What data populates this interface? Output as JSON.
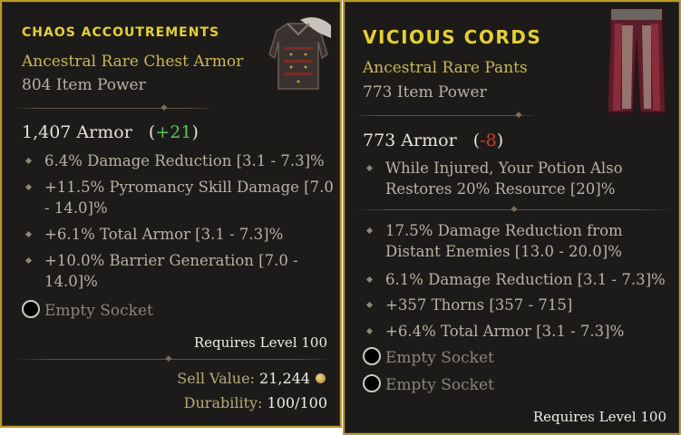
{
  "left_item": {
    "name": "CHAOS ACCOUTREMENTS",
    "subtype": "Ancestral Rare Chest Armor",
    "item_power": "804 Item Power",
    "armor_value": "1,407 Armor",
    "armor_delta": "+21",
    "affixes": [
      {
        "line1": "6.4% Damage Reduction [3.1 - 7.3]%",
        "line2": ""
      },
      {
        "line1": "+11.5% Pyromancy Skill Damage [7.0",
        "line2": "- 14.0]%"
      },
      {
        "line1": "+6.1% Total Armor [3.1 - 7.3]%",
        "line2": ""
      },
      {
        "line1": "+10.0% Barrier Generation [7.0 -",
        "line2": "14.0]%"
      }
    ],
    "sockets": [
      "Empty Socket"
    ],
    "requires": "Requires Level 100",
    "sell_label": "Sell Value:",
    "sell_value": "21,244",
    "durability_label": "Durability:",
    "durability_value": "100/100"
  },
  "right_item": {
    "name": "VICIOUS CORDS",
    "subtype": "Ancestral Rare Pants",
    "item_power": "773 Item Power",
    "armor_value": "773 Armor",
    "armor_delta": "-8",
    "implicit": {
      "line1": "While Injured, Your Potion Also",
      "line2": "Restores 20% Resource [20]%"
    },
    "affixes": [
      {
        "line1": "17.5% Damage Reduction from",
        "line2": "Distant Enemies [13.0 - 20.0]%"
      },
      {
        "line1": "6.1% Damage Reduction [3.1 - 7.3]%",
        "line2": ""
      },
      {
        "line1": "+357 Thorns [357 - 715]",
        "line2": ""
      },
      {
        "line1": "+6.4% Total Armor [3.1 - 7.3]%",
        "line2": ""
      }
    ],
    "sockets": [
      "Empty Socket",
      "Empty Socket"
    ],
    "requires": "Requires Level 100"
  },
  "colors": {
    "border": "#b79a2a",
    "name": "#e4cf35",
    "subtype": "#c9b75a",
    "positive": "#5ac65a",
    "negative": "#d23a31"
  },
  "icons": [
    "chest-armor-icon",
    "pants-icon",
    "gold-coin-icon",
    "socket-icon",
    "bullet-diamond-icon"
  ]
}
